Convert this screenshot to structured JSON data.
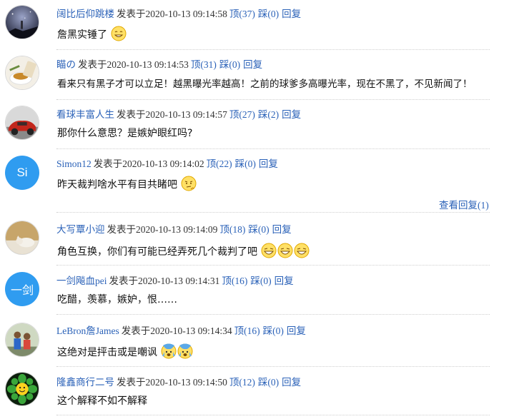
{
  "comments": [
    {
      "user": "阔比后仰跳楼",
      "posted": "发表于",
      "time": "2020-10-13 09:14:58",
      "up": "顶(37)",
      "down": "踩(0)",
      "reply": "回复",
      "text": "詹黑实锤了",
      "avatar": "night-sky-avatar",
      "emojis": [
        "grin"
      ]
    },
    {
      "user": "瞄の",
      "posted": "发表于",
      "time": "2020-10-13 09:14:53",
      "up": "顶(31)",
      "down": "踩(0)",
      "reply": "回复",
      "text": "看来只有黑子才可以立足！越黑曝光率越高！之前的球爹多高曝光率，现在不黑了，不见新闻了！",
      "avatar": "tea-avatar",
      "emojis": []
    },
    {
      "user": "看球丰富人生",
      "posted": "发表于",
      "time": "2020-10-13 09:14:57",
      "up": "顶(27)",
      "down": "踩(2)",
      "reply": "回复",
      "text": "那你什么意思？是嫉妒眼红吗?",
      "avatar": "red-car-avatar",
      "emojis": []
    },
    {
      "user": "Simon12",
      "posted": "发表于",
      "time": "2020-10-13 09:14:02",
      "up": "顶(22)",
      "down": "踩(0)",
      "reply": "回复",
      "text": "昨天裁判啥水平有目共睹吧",
      "avatar_text": "Si",
      "emojis": [
        "thinking"
      ]
    },
    {
      "user": "大写覃小迎",
      "posted": "发表于",
      "time": "2020-10-13 09:14:09",
      "up": "顶(18)",
      "down": "踩(0)",
      "reply": "回复",
      "text": "角色互换，你们有可能已经弄死几个裁判了吧",
      "avatar": "cat-avatar",
      "emojis": [
        "laugh",
        "laugh",
        "laugh"
      ]
    },
    {
      "user": "一剑飚血pei",
      "posted": "发表于",
      "time": "2020-10-13 09:14:31",
      "up": "顶(16)",
      "down": "踩(0)",
      "reply": "回复",
      "text": "吃醋，羡慕，嫉妒，恨……",
      "avatar_text": "一剑",
      "emojis": []
    },
    {
      "user": "LeBron詹James",
      "posted": "发表于",
      "time": "2020-10-13 09:14:34",
      "up": "顶(16)",
      "down": "踩(0)",
      "reply": "回复",
      "text": "这绝对是抨击或是嘲讽",
      "avatar": "photo-avatar",
      "emojis": [
        "fearful",
        "fearful"
      ]
    },
    {
      "user": "隆鑫商行二号",
      "posted": "发表于",
      "time": "2020-10-13 09:14:50",
      "up": "顶(12)",
      "down": "踩(0)",
      "reply": "回复",
      "text": "这个解释不如不解释",
      "avatar": "smiley-avatar",
      "emojis": []
    }
  ],
  "view_replies": "查看回复(1)"
}
